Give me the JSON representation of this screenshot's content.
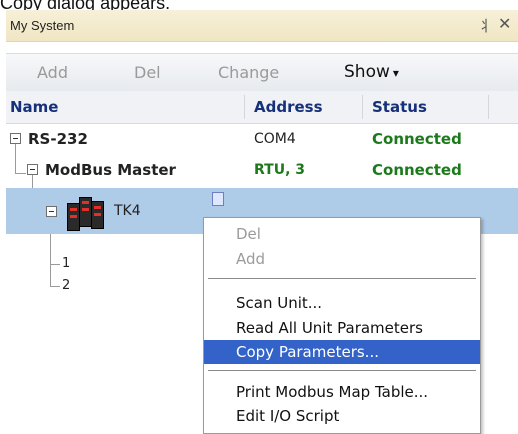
{
  "caption": "Copy dialog appears.",
  "panel": {
    "title": "My System",
    "pin_icon": "pin-icon",
    "close_icon": "close-icon"
  },
  "toolbar": {
    "add": "Add",
    "del": "Del",
    "change": "Change",
    "show": "Show"
  },
  "columns": {
    "name": "Name",
    "address": "Address",
    "status": "Status"
  },
  "tree": {
    "rs232": {
      "label": "RS-232",
      "address": "COM4",
      "status": "Connected"
    },
    "modbus": {
      "label": "ModBus Master",
      "address": "RTU, 3",
      "status": "Connected"
    },
    "tk4": {
      "label": "TK4"
    },
    "children": [
      "1",
      "2"
    ]
  },
  "context_menu": {
    "items": [
      {
        "label": "Del",
        "enabled": false
      },
      {
        "label": "Add",
        "enabled": false
      },
      {
        "label": "Scan Unit...",
        "enabled": true
      },
      {
        "label": "Read All Unit Parameters",
        "enabled": true
      },
      {
        "label": "Copy Parameters...",
        "enabled": true,
        "selected": true
      },
      {
        "label": "Print Modbus Map Table...",
        "enabled": true
      },
      {
        "label": "Edit I/O Script",
        "enabled": true
      }
    ]
  },
  "colors": {
    "connected": "#1c7a1c",
    "header_text": "#16317a",
    "selection": "#aecbe8",
    "menu_highlight": "#3363c8"
  }
}
